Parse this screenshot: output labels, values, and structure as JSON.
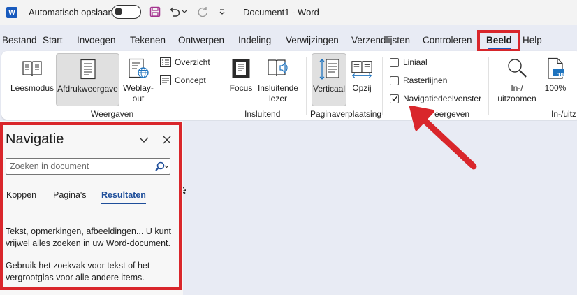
{
  "titlebar": {
    "app_letter": "W",
    "autosave_label": "Automatisch opslaan",
    "document_title": "Document1  -  Word",
    "icons": [
      "word-logo-icon",
      "save-icon",
      "undo-icon",
      "undo-dropdown-icon",
      "redo-icon",
      "customize-quick-access-icon"
    ]
  },
  "menu": {
    "tabs": [
      "Bestand",
      "Start",
      "Invoegen",
      "Tekenen",
      "Ontwerpen",
      "Indeling",
      "Verwijzingen",
      "Verzendlijsten",
      "Controleren",
      "Beeld",
      "Help"
    ],
    "active": "Beeld"
  },
  "ribbon": {
    "weergaven": {
      "label": "Weergaven",
      "leesmodus": "Leesmodus",
      "afdrukweergave": "Afdrukweergave",
      "weblay_line1": "Weblay-",
      "weblay_line2": "out",
      "overzicht": "Overzicht",
      "concept": "Concept"
    },
    "insluitend": {
      "label": "Insluitend",
      "focus": "Focus",
      "insluitende_line1": "Insluitende",
      "insluitende_line2": "lezer"
    },
    "paginaverplaatsing": {
      "label": "Paginaverplaatsing",
      "verticaal": "Verticaal",
      "opzij": "Opzij"
    },
    "weergeven": {
      "label_partial": "eergeven",
      "liniaal": "Liniaal",
      "rasterlijnen": "Rasterlijnen",
      "navigatiedeelvenster": "Navigatiedeelvenster",
      "liniaal_checked": false,
      "rasterlijnen_checked": false,
      "navigatiedeelvenster_checked": true
    },
    "inzoomen": {
      "label_partial": "In-/uitz",
      "in_uit_line1": "In-/",
      "in_uit_line2": "uitzoomen",
      "percent": "100%",
      "page_badge": "100"
    }
  },
  "navigation": {
    "title": "Navigatie",
    "search_placeholder": "Zoeken in document",
    "tabs": [
      "Koppen",
      "Pagina's",
      "Resultaten"
    ],
    "active_tab": "Resultaten",
    "text1_line1": "Tekst, opmerkingen, afbeeldingen... U kunt",
    "text1_line2": "vrijwel alles zoeken in uw Word-document.",
    "text2_line1": "Gebruik het zoekvak voor tekst of het",
    "text2_line2": "vergrootglas voor alle andere items."
  },
  "colors": {
    "highlight_red": "#d9262b",
    "word_blue": "#185abd",
    "save_purple": "#a4338f",
    "active_tab_blue": "#1e4e9a"
  }
}
